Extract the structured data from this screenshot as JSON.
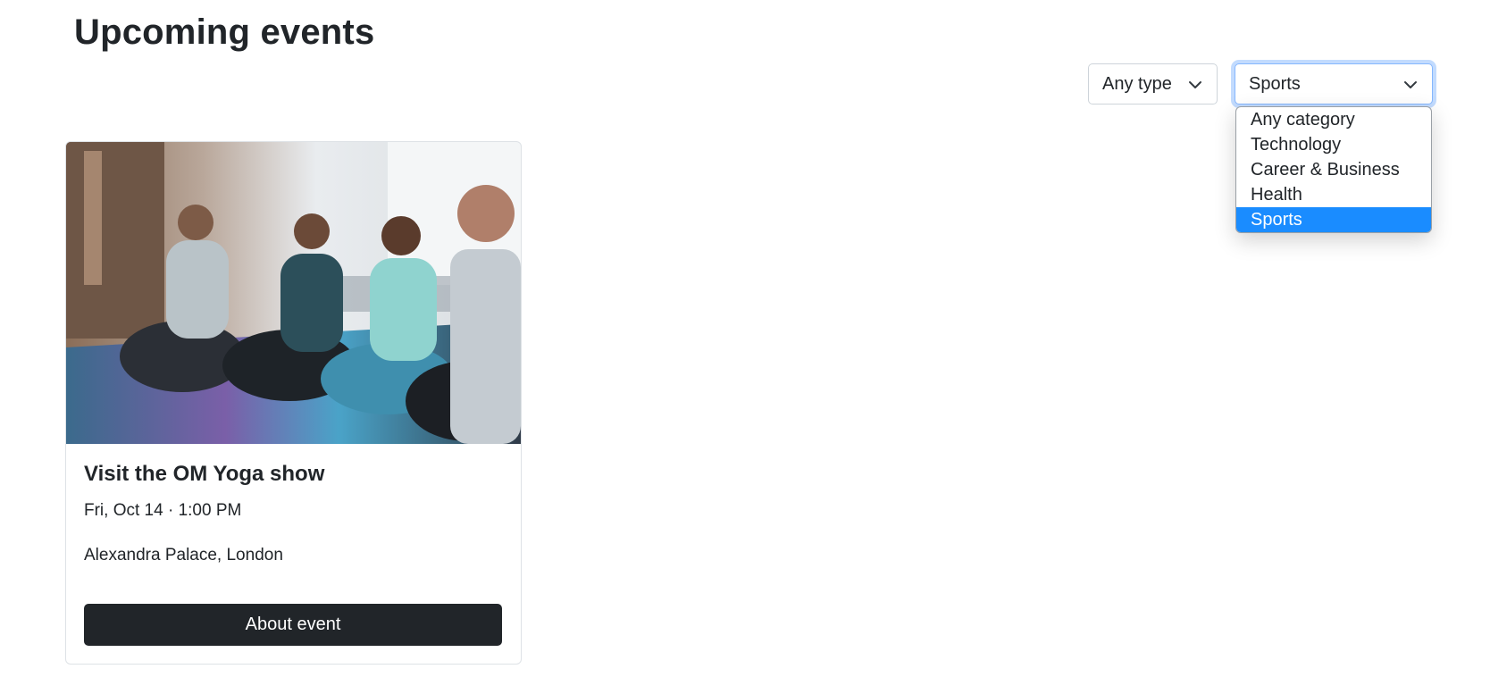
{
  "header": {
    "title": "Upcoming events"
  },
  "filters": {
    "type_select": {
      "value": "Any type"
    },
    "category_select": {
      "value": "Sports",
      "options": [
        "Any category",
        "Technology",
        "Career & Business",
        "Health",
        "Sports"
      ],
      "selected_index": 4
    }
  },
  "event_card": {
    "title": "Visit the OM Yoga show",
    "datetime": "Fri, Oct 14 · 1:00 PM",
    "venue": "Alexandra Palace, London",
    "button_label": "About event"
  },
  "colors": {
    "accent": "#1a8cff",
    "button_bg": "#212529",
    "focus_border": "#86b7fe"
  }
}
